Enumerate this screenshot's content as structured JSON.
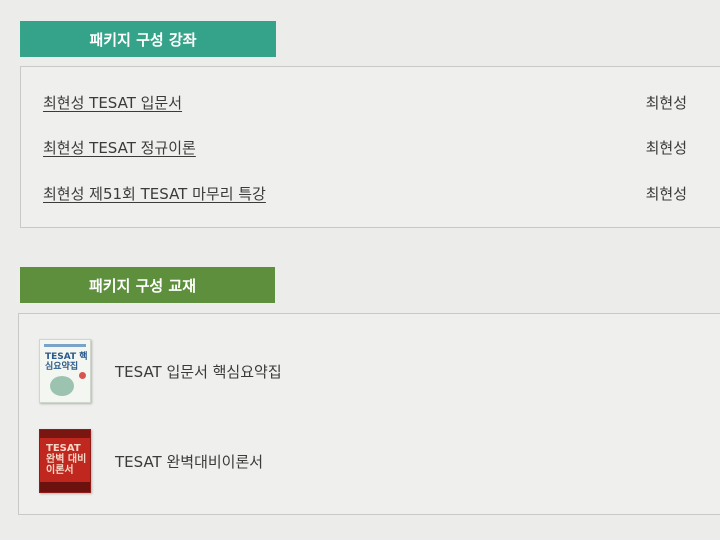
{
  "sections": {
    "lectures": {
      "header": "패키지 구성 강좌",
      "courses": [
        {
          "title": "최현성 TESAT 입문서",
          "instructor": "최현성"
        },
        {
          "title": "최현성 TESAT 정규이론",
          "instructor": "최현성"
        },
        {
          "title": "최현성 제51회 TESAT 마무리 특강",
          "instructor": "최현성"
        }
      ]
    },
    "books": {
      "header": "패키지 구성 교재",
      "items": [
        {
          "title": "TESAT 입문서 핵심요약집",
          "cover_label": "TESAT 핵심요약집"
        },
        {
          "title": "TESAT 완벽대비이론서",
          "cover_label": "TESAT 완벽 대비 이론서"
        }
      ]
    }
  },
  "colors": {
    "lecture_header": "#35a38a",
    "book_header": "#5e8f3d"
  }
}
